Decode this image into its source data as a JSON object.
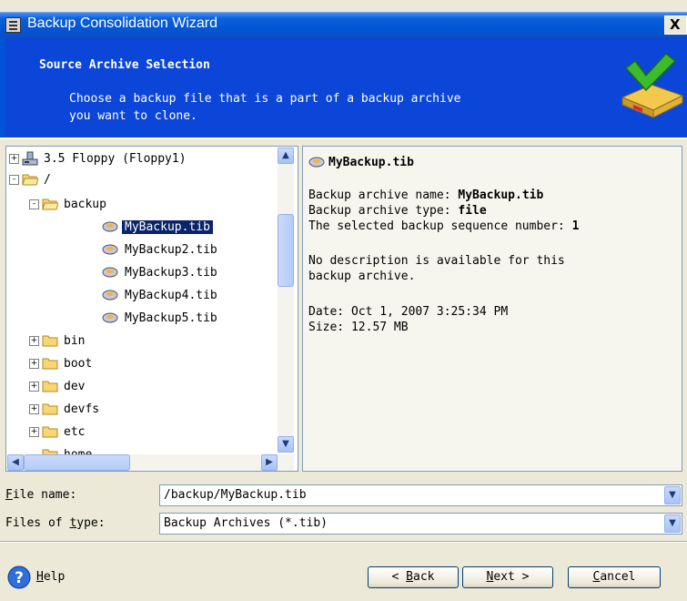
{
  "window": {
    "title": "Backup Consolidation Wizard",
    "close_glyph": "X",
    "sysmenu_icon": "window-menu-icon"
  },
  "header": {
    "title": "Source Archive Selection",
    "description": "Choose a backup file that is a part of a backup archive\nyou want to clone.",
    "icon": "wizard-archive-icon"
  },
  "tree": {
    "items": [
      {
        "label": "3.5 Floppy (Floppy1)",
        "icon": "floppy-drive-icon",
        "expander": "+"
      },
      {
        "label": "/",
        "icon": "open-folder-icon",
        "expander": "-"
      },
      {
        "label": "backup",
        "icon": "open-folder-icon",
        "expander": "-"
      },
      {
        "label": "MyBackup.tib",
        "icon": "backup-archive-icon",
        "selected": true
      },
      {
        "label": "MyBackup2.tib",
        "icon": "backup-archive-icon"
      },
      {
        "label": "MyBackup3.tib",
        "icon": "backup-archive-icon"
      },
      {
        "label": "MyBackup4.tib",
        "icon": "backup-archive-icon"
      },
      {
        "label": "MyBackup5.tib",
        "icon": "backup-archive-icon"
      },
      {
        "label": "bin",
        "icon": "folder-icon",
        "expander": "+"
      },
      {
        "label": "boot",
        "icon": "folder-icon",
        "expander": "+"
      },
      {
        "label": "dev",
        "icon": "folder-icon",
        "expander": "+"
      },
      {
        "label": "devfs",
        "icon": "folder-icon",
        "expander": "+"
      },
      {
        "label": "etc",
        "icon": "folder-icon",
        "expander": "+"
      },
      {
        "label": "home",
        "icon": "folder-icon"
      }
    ]
  },
  "info": {
    "file": "MyBackup.tib",
    "name_label": "Backup archive name: ",
    "name_value": "MyBackup.tib",
    "type_label": "Backup archive type: ",
    "type_value": "file",
    "seq_label": "The selected backup sequence number: ",
    "seq_value": "1",
    "desc_line1": "No description is available for this",
    "desc_line2": "backup archive.",
    "date": "Date: Oct 1, 2007 3:25:34 PM",
    "size": "Size: 12.57 MB"
  },
  "fields": {
    "file_name_label_u": "F",
    "file_name_label_rest": "ile name:",
    "file_name_value": "/backup/MyBackup.tib",
    "files_type_label_pre": "Files of ",
    "files_type_label_u": "t",
    "files_type_label_rest": "ype:",
    "files_type_value": "Backup Archives (*.tib)"
  },
  "buttons": {
    "help_u": "H",
    "help_rest": "elp",
    "back_pre": "< ",
    "back_u": "B",
    "back_rest": "ack",
    "next_u": "N",
    "next_rest": "ext >",
    "cancel_u": "C",
    "cancel_rest": "ancel"
  }
}
